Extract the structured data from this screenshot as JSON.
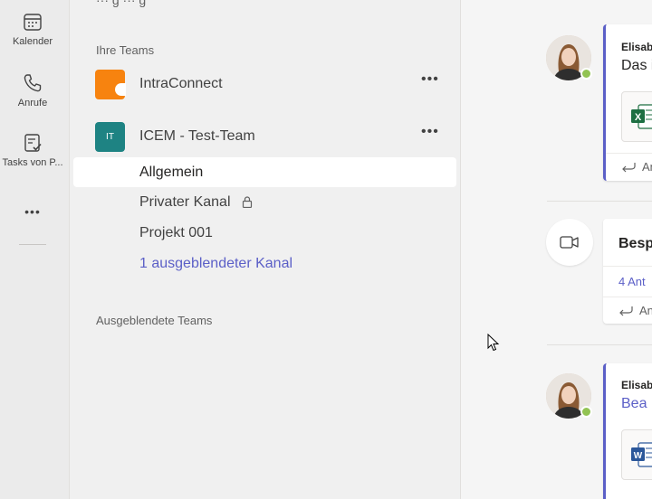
{
  "rail": {
    "items": [
      {
        "label": "Kalender",
        "icon": "calendar-icon"
      },
      {
        "label": "Anrufe",
        "icon": "phone-icon"
      },
      {
        "label": "Tasks von P...",
        "icon": "tasks-icon"
      }
    ],
    "more": "•••"
  },
  "panel": {
    "top_cut_text": "··· g ··· g",
    "your_teams_label": "Ihre Teams",
    "teams": [
      {
        "name": "IntraConnect",
        "avatar_color": "#f7830f",
        "more": "•••"
      },
      {
        "name": "ICEM - Test-Team",
        "initials": "IT",
        "avatar_color": "#1e8383",
        "more": "•••"
      }
    ],
    "channels": [
      {
        "label": "Allgemein"
      },
      {
        "label": "Privater Kanal",
        "icon": "lock-icon"
      },
      {
        "label": "Projekt 001"
      },
      {
        "label": "1 ausgeblendeter Kanal"
      }
    ],
    "hidden_teams_label": "Ausgeblendete Teams"
  },
  "chat": {
    "post1": {
      "author": "Elisab",
      "text": "Das i",
      "file_icon": "excel-icon",
      "reply": "An"
    },
    "post2": {
      "title": "Besp",
      "replies": "4 Ant",
      "reply": "An",
      "icon": "video-camera-icon"
    },
    "post3": {
      "author": "Elisab",
      "text": "Bea E",
      "file_icon": "word-icon"
    }
  },
  "colors": {
    "accent": "#5b5fc7",
    "presence": "#92c353",
    "excel": "#1d6f42",
    "word": "#2b579a"
  }
}
